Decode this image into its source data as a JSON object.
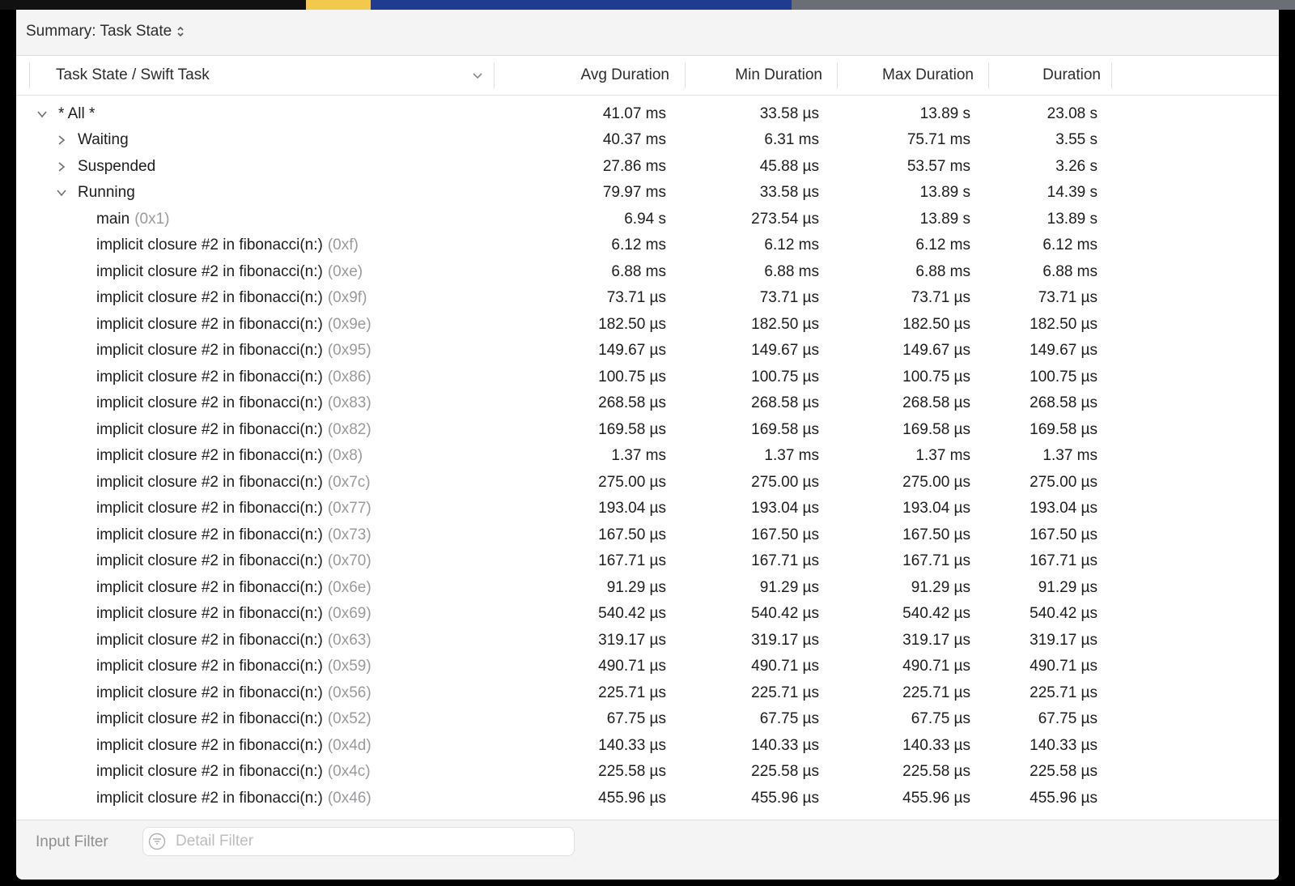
{
  "colors": {
    "accent_yellow": "#f2c94c",
    "accent_blue": "#1f3c8e",
    "accent_gray": "#6b6e74"
  },
  "summary": {
    "label": "Summary: Task State"
  },
  "columns": {
    "name": "Task State / Swift Task",
    "avg": "Avg Duration",
    "min": "Min Duration",
    "max": "Max Duration",
    "duration": "Duration"
  },
  "rows": [
    {
      "disclosure": "chevron-down-icon",
      "name": "* All *",
      "addr": "",
      "avg": "41.07 ms",
      "min": "33.58 µs",
      "max": "13.89 s",
      "dur": "23.08 s"
    },
    {
      "disclosure": "chevron-right-icon",
      "name": "Waiting",
      "addr": "",
      "avg": "40.37 ms",
      "min": "6.31 ms",
      "max": "75.71 ms",
      "dur": "3.55 s"
    },
    {
      "disclosure": "chevron-right-icon",
      "name": "Suspended",
      "addr": "",
      "avg": "27.86 ms",
      "min": "45.88 µs",
      "max": "53.57 ms",
      "dur": "3.26 s"
    },
    {
      "disclosure": "chevron-down-icon",
      "name": "Running",
      "addr": "",
      "avg": "79.97 ms",
      "min": "33.58 µs",
      "max": "13.89 s",
      "dur": "14.39 s"
    },
    {
      "disclosure": "",
      "name": "main",
      "addr": "(0x1)",
      "avg": "6.94 s",
      "min": "273.54 µs",
      "max": "13.89 s",
      "dur": "13.89 s"
    },
    {
      "disclosure": "",
      "name": "implicit closure #2 in fibonacci(n:)",
      "addr": "(0xf)",
      "avg": "6.12 ms",
      "min": "6.12 ms",
      "max": "6.12 ms",
      "dur": "6.12 ms"
    },
    {
      "disclosure": "",
      "name": "implicit closure #2 in fibonacci(n:)",
      "addr": "(0xe)",
      "avg": "6.88 ms",
      "min": "6.88 ms",
      "max": "6.88 ms",
      "dur": "6.88 ms"
    },
    {
      "disclosure": "",
      "name": "implicit closure #2 in fibonacci(n:)",
      "addr": "(0x9f)",
      "avg": "73.71 µs",
      "min": "73.71 µs",
      "max": "73.71 µs",
      "dur": "73.71 µs"
    },
    {
      "disclosure": "",
      "name": "implicit closure #2 in fibonacci(n:)",
      "addr": "(0x9e)",
      "avg": "182.50 µs",
      "min": "182.50 µs",
      "max": "182.50 µs",
      "dur": "182.50 µs"
    },
    {
      "disclosure": "",
      "name": "implicit closure #2 in fibonacci(n:)",
      "addr": "(0x95)",
      "avg": "149.67 µs",
      "min": "149.67 µs",
      "max": "149.67 µs",
      "dur": "149.67 µs"
    },
    {
      "disclosure": "",
      "name": "implicit closure #2 in fibonacci(n:)",
      "addr": "(0x86)",
      "avg": "100.75 µs",
      "min": "100.75 µs",
      "max": "100.75 µs",
      "dur": "100.75 µs"
    },
    {
      "disclosure": "",
      "name": "implicit closure #2 in fibonacci(n:)",
      "addr": "(0x83)",
      "avg": "268.58 µs",
      "min": "268.58 µs",
      "max": "268.58 µs",
      "dur": "268.58 µs"
    },
    {
      "disclosure": "",
      "name": "implicit closure #2 in fibonacci(n:)",
      "addr": "(0x82)",
      "avg": "169.58 µs",
      "min": "169.58 µs",
      "max": "169.58 µs",
      "dur": "169.58 µs"
    },
    {
      "disclosure": "",
      "name": "implicit closure #2 in fibonacci(n:)",
      "addr": "(0x8)",
      "avg": "1.37 ms",
      "min": "1.37 ms",
      "max": "1.37 ms",
      "dur": "1.37 ms"
    },
    {
      "disclosure": "",
      "name": "implicit closure #2 in fibonacci(n:)",
      "addr": "(0x7c)",
      "avg": "275.00 µs",
      "min": "275.00 µs",
      "max": "275.00 µs",
      "dur": "275.00 µs"
    },
    {
      "disclosure": "",
      "name": "implicit closure #2 in fibonacci(n:)",
      "addr": "(0x77)",
      "avg": "193.04 µs",
      "min": "193.04 µs",
      "max": "193.04 µs",
      "dur": "193.04 µs"
    },
    {
      "disclosure": "",
      "name": "implicit closure #2 in fibonacci(n:)",
      "addr": "(0x73)",
      "avg": "167.50 µs",
      "min": "167.50 µs",
      "max": "167.50 µs",
      "dur": "167.50 µs"
    },
    {
      "disclosure": "",
      "name": "implicit closure #2 in fibonacci(n:)",
      "addr": "(0x70)",
      "avg": "167.71 µs",
      "min": "167.71 µs",
      "max": "167.71 µs",
      "dur": "167.71 µs"
    },
    {
      "disclosure": "",
      "name": "implicit closure #2 in fibonacci(n:)",
      "addr": "(0x6e)",
      "avg": "91.29 µs",
      "min": "91.29 µs",
      "max": "91.29 µs",
      "dur": "91.29 µs"
    },
    {
      "disclosure": "",
      "name": "implicit closure #2 in fibonacci(n:)",
      "addr": "(0x69)",
      "avg": "540.42 µs",
      "min": "540.42 µs",
      "max": "540.42 µs",
      "dur": "540.42 µs"
    },
    {
      "disclosure": "",
      "name": "implicit closure #2 in fibonacci(n:)",
      "addr": "(0x63)",
      "avg": "319.17 µs",
      "min": "319.17 µs",
      "max": "319.17 µs",
      "dur": "319.17 µs"
    },
    {
      "disclosure": "",
      "name": "implicit closure #2 in fibonacci(n:)",
      "addr": "(0x59)",
      "avg": "490.71 µs",
      "min": "490.71 µs",
      "max": "490.71 µs",
      "dur": "490.71 µs"
    },
    {
      "disclosure": "",
      "name": "implicit closure #2 in fibonacci(n:)",
      "addr": "(0x56)",
      "avg": "225.71 µs",
      "min": "225.71 µs",
      "max": "225.71 µs",
      "dur": "225.71 µs"
    },
    {
      "disclosure": "",
      "name": "implicit closure #2 in fibonacci(n:)",
      "addr": "(0x52)",
      "avg": "67.75 µs",
      "min": "67.75 µs",
      "max": "67.75 µs",
      "dur": "67.75 µs"
    },
    {
      "disclosure": "",
      "name": "implicit closure #2 in fibonacci(n:)",
      "addr": "(0x4d)",
      "avg": "140.33 µs",
      "min": "140.33 µs",
      "max": "140.33 µs",
      "dur": "140.33 µs"
    },
    {
      "disclosure": "",
      "name": "implicit closure #2 in fibonacci(n:)",
      "addr": "(0x4c)",
      "avg": "225.58 µs",
      "min": "225.58 µs",
      "max": "225.58 µs",
      "dur": "225.58 µs"
    },
    {
      "disclosure": "",
      "name": "implicit closure #2 in fibonacci(n:)",
      "addr": "(0x46)",
      "avg": "455.96 µs",
      "min": "455.96 µs",
      "max": "455.96 µs",
      "dur": "455.96 µs"
    }
  ],
  "bottom": {
    "input_filter": "Input Filter",
    "detail_filter_placeholder": "Detail Filter"
  }
}
